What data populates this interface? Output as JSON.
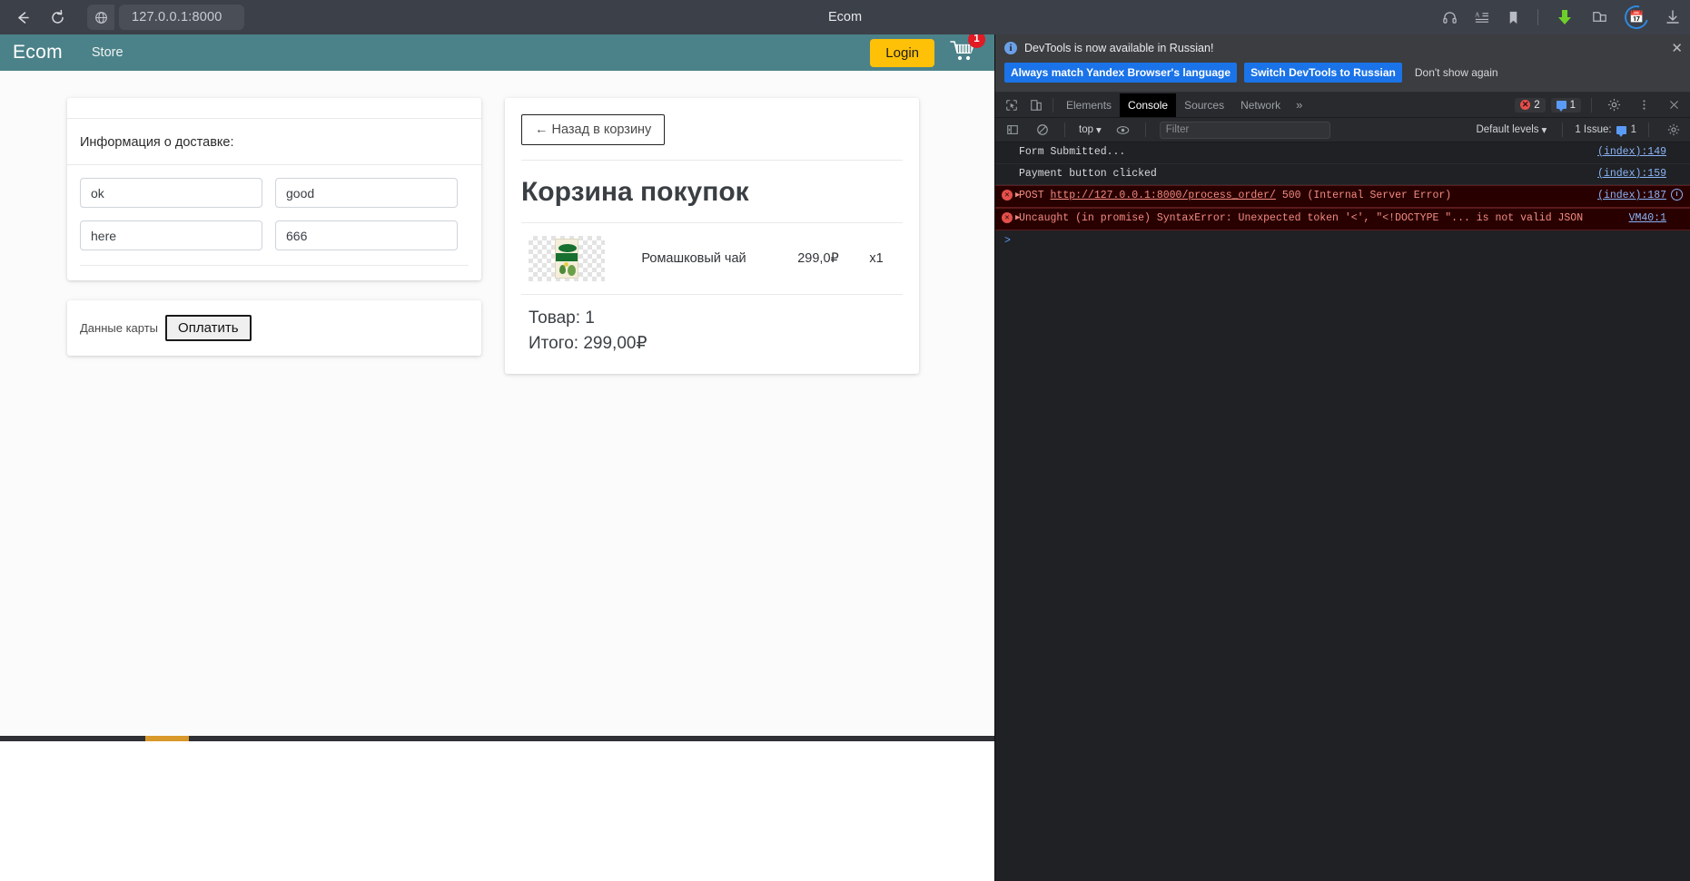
{
  "browser": {
    "address": "127.0.0.1:8000",
    "tab_title": "Ecom",
    "back_icon": "back-arrow-icon",
    "reload_icon": "reload-icon",
    "shield_icon": "site-info-icon",
    "toolbar_icons": [
      "headphones-icon",
      "reader-mode-icon",
      "bookmark-icon",
      "download-green-icon",
      "collections-icon",
      "calendar-icon",
      "downloads-icon"
    ]
  },
  "site": {
    "brand": "Ecom",
    "nav_store": "Store",
    "login_label": "Login",
    "cart_icon": "shopping-cart-icon",
    "cart_badge": "1"
  },
  "delivery": {
    "heading": "Информация о доставке:",
    "fields": [
      {
        "name": "delivery-field-1",
        "value": "ok"
      },
      {
        "name": "delivery-field-2",
        "value": "good"
      },
      {
        "name": "delivery-field-3",
        "value": "here"
      },
      {
        "name": "delivery-field-4",
        "value": "666"
      }
    ]
  },
  "payment": {
    "card_data_label": "Данные карты",
    "pay_button": "Оплатить"
  },
  "cart": {
    "back_button": "← Назад в корзину",
    "title": "Корзина покупок",
    "item": {
      "image_alt": "chamomile-tea-box",
      "name": "Ромашковый чай",
      "price": "299,0₽",
      "qty": "x1"
    },
    "count_line": "Товар: 1",
    "total_line": "Итого: 299,00₽"
  },
  "devtools": {
    "banner": {
      "text": "DevTools is now available in Russian!",
      "primary_btn": "Always match Yandex Browser's language",
      "secondary_btn": "Switch DevTools to Russian",
      "dismiss_btn": "Don't show again",
      "close_icon": "close-icon"
    },
    "tabs": [
      {
        "label": "Elements",
        "active": false
      },
      {
        "label": "Console",
        "active": true
      },
      {
        "label": "Sources",
        "active": false
      },
      {
        "label": "Network",
        "active": false
      }
    ],
    "more_tabs": "»",
    "error_count": "2",
    "message_count": "1",
    "settings_icon": "gear-icon",
    "kebab_icon": "more-vertical-icon",
    "close_icon": "close-icon",
    "inspect_icon": "inspect-element-icon",
    "device_icon": "device-toolbar-icon",
    "filterbar": {
      "sidebar_icon": "console-sidebar-icon",
      "clear_icon": "clear-console-icon",
      "context": "top",
      "eye_icon": "live-expression-icon",
      "filter_placeholder": "Filter",
      "levels": "Default levels",
      "issues": "1 Issue:",
      "issues_count": "1",
      "settings_icon": "gear-icon"
    },
    "console_rows": [
      {
        "type": "log",
        "text": "Form Submitted...",
        "source": "(index):149"
      },
      {
        "type": "log",
        "text": "Payment button clicked",
        "source": "(index):159"
      },
      {
        "type": "error",
        "prefix": "POST ",
        "link": "http://127.0.0.1:8000/process_order/",
        "suffix": " 500 (Internal Server Error)",
        "source": "(index):187"
      },
      {
        "type": "error",
        "text": "Uncaught (in promise) SyntaxError: Unexpected token '<', \"<!DOCTYPE \"... is not valid JSON",
        "source": "VM40:1"
      }
    ],
    "prompt": ">"
  },
  "colors": {
    "navbar": "#4b8289",
    "login": "#ffc107",
    "badge": "#e01b24",
    "devtools_bg": "#202124",
    "error_bg": "#290000",
    "link": "#8ab4f8"
  }
}
